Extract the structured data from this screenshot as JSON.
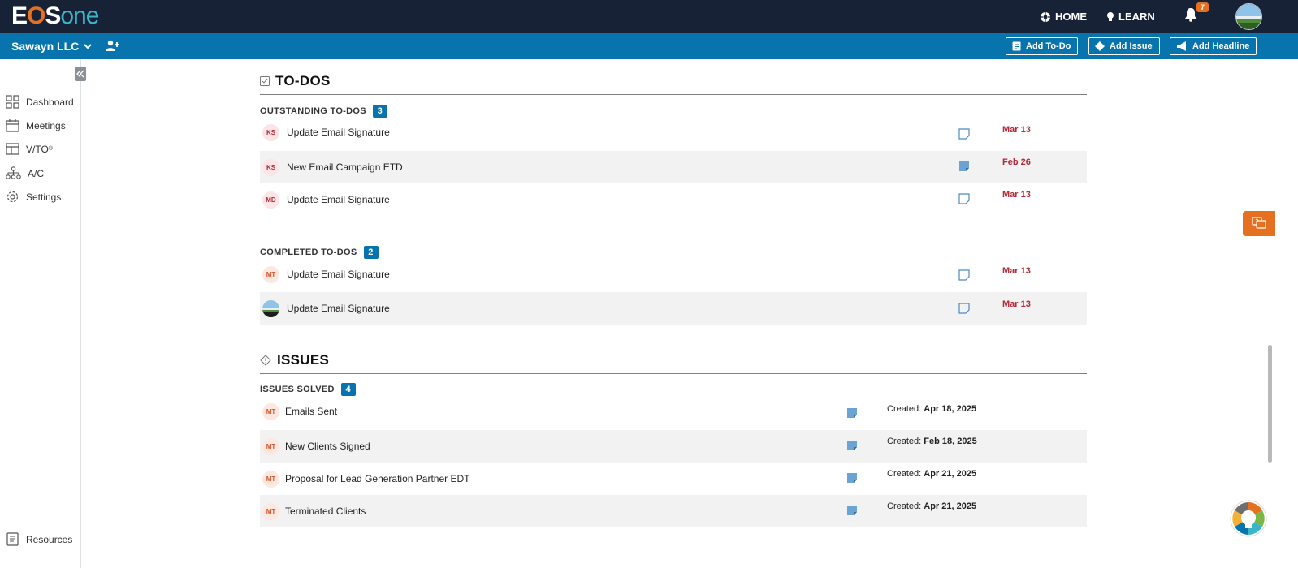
{
  "header": {
    "logo_part1": "E",
    "logo_part2": "O",
    "logo_part3": "S",
    "logo_part4": "one",
    "home_label": "HOME",
    "learn_label": "LEARN",
    "notification_count": "7"
  },
  "subheader": {
    "company": "Sawayn LLC",
    "add_todo": "Add To-Do",
    "add_issue": "Add Issue",
    "add_headline": "Add Headline"
  },
  "sidebar": {
    "items": [
      {
        "label": "Dashboard"
      },
      {
        "label": "Meetings"
      },
      {
        "label": "V/TO",
        "sup": "®"
      },
      {
        "label": "A/C"
      },
      {
        "label": "Settings"
      }
    ],
    "resources": "Resources"
  },
  "todos": {
    "title": "TO-DOS",
    "outstanding": {
      "label": "OUTSTANDING TO-DOS",
      "count": "3",
      "items": [
        {
          "initials": "KS",
          "title": "Update Email Signature",
          "due": "Mar 13"
        },
        {
          "initials": "KS",
          "title": "New Email Campaign ETD",
          "due": "Feb 26"
        },
        {
          "initials": "MD",
          "title": "Update Email Signature",
          "due": "Mar 13"
        }
      ]
    },
    "completed": {
      "label": "COMPLETED TO-DOS",
      "count": "2",
      "items": [
        {
          "initials": "MT",
          "title": "Update Email Signature",
          "due": "Mar 13"
        },
        {
          "initials": "",
          "title": "Update Email Signature",
          "due": "Mar 13"
        }
      ]
    }
  },
  "issues": {
    "title": "ISSUES",
    "solved": {
      "label": "ISSUES SOLVED",
      "count": "4",
      "created_label": "Created:",
      "items": [
        {
          "initials": "MT",
          "title": "Emails Sent",
          "created": "Apr 18, 2025"
        },
        {
          "initials": "MT",
          "title": "New Clients Signed",
          "created": "Feb 18, 2025"
        },
        {
          "initials": "MT",
          "title": "Proposal for Lead Generation Partner EDT",
          "created": "Apr 21, 2025"
        },
        {
          "initials": "MT",
          "title": "Terminated Clients",
          "created": "Apr 21, 2025"
        }
      ]
    }
  },
  "colors": {
    "topbar": "#172236",
    "subbar": "#0874ae",
    "accent_orange": "#e5701f",
    "due_red": "#b02a3a"
  }
}
